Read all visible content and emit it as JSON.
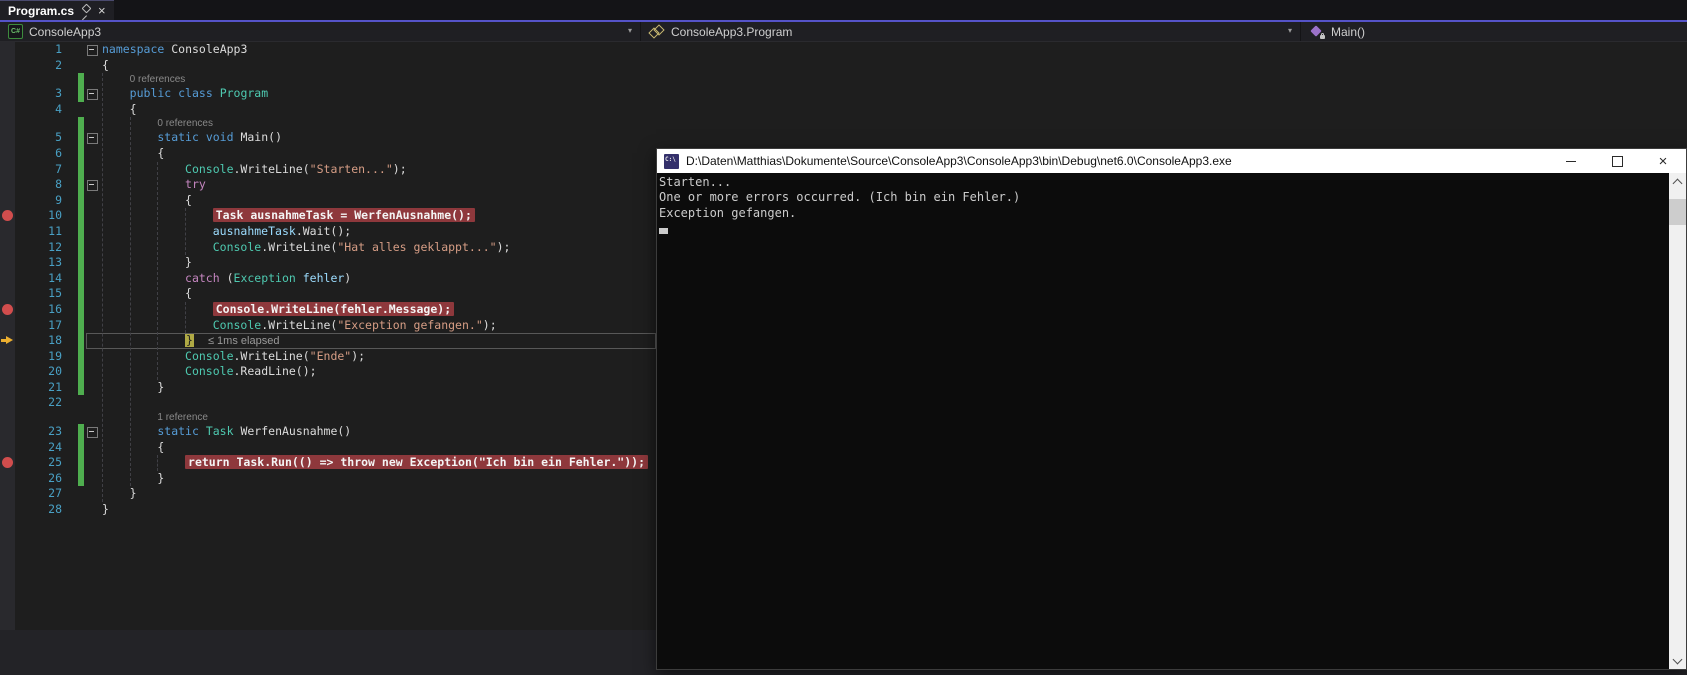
{
  "tab_bar": {
    "tab_title": "Program.cs"
  },
  "nav_bar": {
    "project_label": "ConsoleApp3",
    "type_label": "ConsoleApp3.Program",
    "member_label": "Main()",
    "dropdown_glyph": "▾"
  },
  "editor": {
    "rows": [
      {
        "t": "code",
        "n": "1",
        "ind": 0,
        "fold": true,
        "seg": [
          [
            "k",
            "namespace"
          ],
          [
            "p",
            " ConsoleApp3"
          ]
        ]
      },
      {
        "t": "code",
        "n": "2",
        "ind": 0,
        "seg": [
          [
            "p",
            "{"
          ]
        ]
      },
      {
        "t": "lens",
        "ind": 4,
        "green": true,
        "label": "0 references"
      },
      {
        "t": "code",
        "n": "3",
        "ind": 4,
        "fold": true,
        "green": true,
        "seg": [
          [
            "k",
            "public class"
          ],
          [
            "t",
            " Program"
          ]
        ]
      },
      {
        "t": "code",
        "n": "4",
        "ind": 4,
        "seg": [
          [
            "p",
            "{"
          ]
        ]
      },
      {
        "t": "lens",
        "ind": 8,
        "green": true,
        "label": "0 references"
      },
      {
        "t": "code",
        "n": "5",
        "ind": 8,
        "fold": true,
        "green": true,
        "seg": [
          [
            "k",
            "static void"
          ],
          [
            "p",
            " Main()"
          ]
        ]
      },
      {
        "t": "code",
        "n": "6",
        "ind": 8,
        "green": true,
        "seg": [
          [
            "p",
            "{"
          ]
        ]
      },
      {
        "t": "code",
        "n": "7",
        "ind": 12,
        "green": true,
        "seg": [
          [
            "t",
            "Console"
          ],
          [
            "p",
            ".WriteLine("
          ],
          [
            "s",
            "\"Starten...\""
          ],
          [
            "p",
            ");"
          ]
        ]
      },
      {
        "t": "code",
        "n": "8",
        "ind": 12,
        "fold": true,
        "green": true,
        "seg": [
          [
            "c",
            "try"
          ]
        ]
      },
      {
        "t": "code",
        "n": "9",
        "ind": 12,
        "green": true,
        "seg": [
          [
            "p",
            "{"
          ]
        ]
      },
      {
        "t": "code",
        "n": "10",
        "ind": 16,
        "green": true,
        "bp": true,
        "hl": true,
        "seg": [
          [
            "w",
            "Task ausnahmeTask = WerfenAusnahme();"
          ]
        ]
      },
      {
        "t": "code",
        "n": "11",
        "ind": 16,
        "green": true,
        "seg": [
          [
            "v",
            "ausnahmeTask"
          ],
          [
            "p",
            ".Wait();"
          ]
        ]
      },
      {
        "t": "code",
        "n": "12",
        "ind": 16,
        "green": true,
        "seg": [
          [
            "t",
            "Console"
          ],
          [
            "p",
            ".WriteLine("
          ],
          [
            "s",
            "\"Hat alles geklappt...\""
          ],
          [
            "p",
            ");"
          ]
        ]
      },
      {
        "t": "code",
        "n": "13",
        "ind": 12,
        "green": true,
        "seg": [
          [
            "p",
            "}"
          ]
        ]
      },
      {
        "t": "code",
        "n": "14",
        "ind": 12,
        "green": true,
        "seg": [
          [
            "c",
            "catch"
          ],
          [
            "p",
            " ("
          ],
          [
            "t",
            "Exception"
          ],
          [
            "v",
            " fehler"
          ],
          [
            "p",
            ")"
          ]
        ]
      },
      {
        "t": "code",
        "n": "15",
        "ind": 12,
        "green": true,
        "seg": [
          [
            "p",
            "{"
          ]
        ]
      },
      {
        "t": "code",
        "n": "16",
        "ind": 16,
        "green": true,
        "bp": true,
        "hl": true,
        "seg": [
          [
            "w",
            "Console.WriteLine(fehler.Message);"
          ]
        ]
      },
      {
        "t": "code",
        "n": "17",
        "ind": 16,
        "green": true,
        "seg": [
          [
            "t",
            "Console"
          ],
          [
            "p",
            ".WriteLine("
          ],
          [
            "s",
            "\"Exception gefangen.\""
          ],
          [
            "p",
            ");"
          ]
        ]
      },
      {
        "t": "code",
        "n": "18",
        "ind": 12,
        "green": true,
        "cur": true,
        "seg": [
          [
            "brace",
            "}"
          ]
        ],
        "tip": "≤ 1ms elapsed"
      },
      {
        "t": "code",
        "n": "19",
        "ind": 12,
        "green": true,
        "seg": [
          [
            "t",
            "Console"
          ],
          [
            "p",
            ".WriteLine("
          ],
          [
            "s",
            "\"Ende\""
          ],
          [
            "p",
            ");"
          ]
        ]
      },
      {
        "t": "code",
        "n": "20",
        "ind": 12,
        "green": true,
        "seg": [
          [
            "t",
            "Console"
          ],
          [
            "p",
            ".ReadLine();"
          ]
        ]
      },
      {
        "t": "code",
        "n": "21",
        "ind": 8,
        "green": true,
        "seg": [
          [
            "p",
            "}"
          ]
        ]
      },
      {
        "t": "code",
        "n": "22",
        "ind": 0,
        "seg": []
      },
      {
        "t": "lens",
        "ind": 8,
        "label": "1 reference"
      },
      {
        "t": "code",
        "n": "23",
        "ind": 8,
        "fold": true,
        "green": true,
        "seg": [
          [
            "k",
            "static"
          ],
          [
            "t",
            " Task"
          ],
          [
            "p",
            " WerfenAusnahme()"
          ]
        ]
      },
      {
        "t": "code",
        "n": "24",
        "ind": 8,
        "green": true,
        "seg": [
          [
            "p",
            "{"
          ]
        ]
      },
      {
        "t": "code",
        "n": "25",
        "ind": 12,
        "green": true,
        "bp": true,
        "hl": true,
        "seg": [
          [
            "w",
            "return Task.Run(() => throw new Exception(\"Ich bin ein Fehler.\"));"
          ]
        ]
      },
      {
        "t": "code",
        "n": "26",
        "ind": 8,
        "green": true,
        "seg": [
          [
            "p",
            "}"
          ]
        ]
      },
      {
        "t": "code",
        "n": "27",
        "ind": 4,
        "seg": [
          [
            "p",
            "}"
          ]
        ]
      },
      {
        "t": "code",
        "n": "28",
        "ind": 0,
        "seg": [
          [
            "p",
            "}"
          ]
        ]
      }
    ]
  },
  "console_window": {
    "title": "D:\\Daten\\Matthias\\Dokumente\\Source\\ConsoleApp3\\ConsoleApp3\\bin\\Debug\\net6.0\\ConsoleApp3.exe",
    "output_lines": [
      "Starten...",
      "One or more errors occurred. (Ich bin ein Fehler.)",
      "Exception gefangen."
    ],
    "controls": [
      "minimize",
      "maximize",
      "close"
    ]
  },
  "colors": {
    "accent_line": "#5553C8",
    "keyword": "#569CD6",
    "control_keyword": "#C586C0",
    "type": "#4EC9B0",
    "string": "#D69D85",
    "variable": "#9CDCFE",
    "plain": "#DCDCDC",
    "line_number": "#49A0C4",
    "breakpoint_red": "#D14D4D",
    "breakpoint_line_bg": "#8E383C",
    "change_bar_green": "#4FAE4F",
    "current_brace_bg": "#B0AA45",
    "execution_arrow": "#ECAF30",
    "console_bg": "#0C0C0C",
    "console_text": "#CCCCCC"
  }
}
